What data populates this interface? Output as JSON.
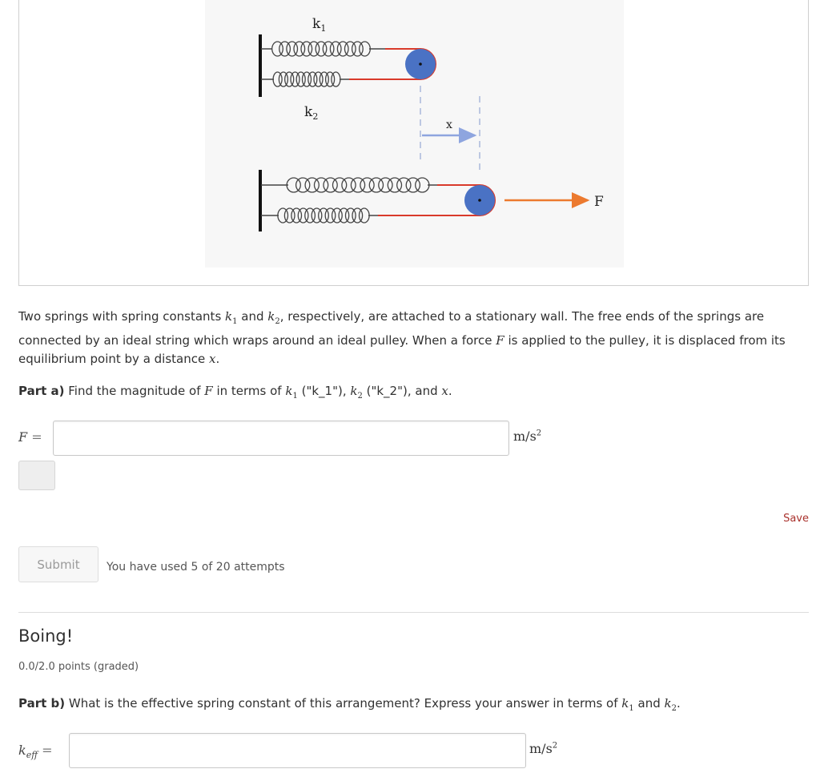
{
  "figure": {
    "k1_label": "k",
    "k1_sub": "1",
    "k2_label": "k",
    "k2_sub": "2",
    "x_label": "x",
    "force_label": "F"
  },
  "problem": {
    "intro_1": "Two springs with spring constants ",
    "k1": "k",
    "k1_sub": "1",
    "intro_2": " and ",
    "k2": "k",
    "k2_sub": "2",
    "intro_3": ", respectively, are attached to a stationary wall. The free ends of the springs are connected by an ideal string which wraps around an ideal pulley. When a force ",
    "F": "F",
    "intro_4": " is applied to the pulley, it is displaced from its equilibrium point by a distance ",
    "x": "x",
    "intro_5": "."
  },
  "part_a": {
    "label": "Part a)",
    "text_1": " Find the magnitude of ",
    "F": "F",
    "text_2": " in terms of ",
    "k1": "k",
    "k1_sub": "1",
    "text_3": " (\"k_1\"), ",
    "k2": "k",
    "k2_sub": "2",
    "text_4": " (\"k_2\"), and ",
    "x": "x",
    "text_5": ".",
    "input_label": "F",
    "equals": "=",
    "input_value": "",
    "unit": "m/s",
    "unit_exp": "2"
  },
  "actions": {
    "save_label": "Save",
    "submit_label": "Submit",
    "attempts_text": "You have used 5 of 20 attempts"
  },
  "section": {
    "title": "Boing!",
    "points": "0.0/2.0 points (graded)"
  },
  "part_b": {
    "label": "Part b)",
    "text_1": " What is the effective spring constant of this arrangement? Express your answer in terms of ",
    "k1": "k",
    "k1_sub": "1",
    "text_2": " and ",
    "k2": "k",
    "k2_sub": "2",
    "text_3": ".",
    "input_label": "k",
    "input_sub": "eff",
    "equals": "=",
    "input_value": "",
    "unit": "m/s",
    "unit_exp": "2"
  },
  "colors": {
    "pulley": "#4a72c4",
    "string": "#d93a2b",
    "force_arrow": "#ec7a2f",
    "displacement_arrow": "#8ea5df",
    "coil": "#444444"
  }
}
